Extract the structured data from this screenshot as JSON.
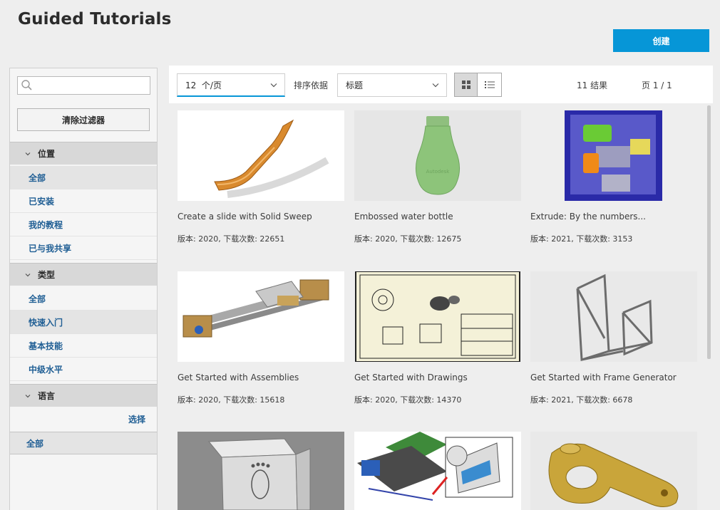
{
  "header": {
    "title": "Guided Tutorials",
    "create_label": "创建"
  },
  "sidebar": {
    "search": {
      "placeholder": "",
      "value": ""
    },
    "clear_filters_label": "清除过滤器",
    "location": {
      "title": "位置",
      "items": [
        {
          "label": "全部",
          "selected": true
        },
        {
          "label": "已安装"
        },
        {
          "label": "我的教程"
        },
        {
          "label": "已与我共享"
        }
      ]
    },
    "type": {
      "title": "类型",
      "items": [
        {
          "label": "全部"
        },
        {
          "label": "快速入门",
          "selected": true
        },
        {
          "label": "基本技能"
        },
        {
          "label": "中级水平"
        }
      ]
    },
    "language": {
      "title": "语言",
      "select_label": "选择",
      "all_label": "全部"
    }
  },
  "toolbar": {
    "per_page": "12  个/页",
    "sort_label": "排序依据",
    "sort_value": "标题",
    "results": "11 结果",
    "page": "页 1 / 1"
  },
  "cards": [
    {
      "title": "Create a slide with Solid Sweep",
      "meta": "版本: 2020, 下载次数: 22651"
    },
    {
      "title": "Embossed water bottle",
      "meta": "版本: 2020, 下载次数: 12675"
    },
    {
      "title": "Extrude: By the numbers...",
      "meta": "版本: 2021, 下载次数: 3153"
    },
    {
      "title": "Get Started with Assemblies",
      "meta": "版本: 2020, 下载次数: 15618"
    },
    {
      "title": "Get Started with Drawings",
      "meta": "版本: 2020, 下载次数: 14370"
    },
    {
      "title": "Get Started with Frame Generator",
      "meta": "版本: 2021, 下载次数: 6678"
    },
    {
      "title": "",
      "meta": ""
    },
    {
      "title": "",
      "meta": ""
    },
    {
      "title": "",
      "meta": ""
    }
  ],
  "colors": {
    "accent": "#0696d7",
    "link": "#1f5e94",
    "background": "#eeeeee"
  },
  "icons": {
    "search": "search-icon",
    "chevron": "chevron-down-icon",
    "grid": "grid-view-icon",
    "list": "list-view-icon"
  }
}
